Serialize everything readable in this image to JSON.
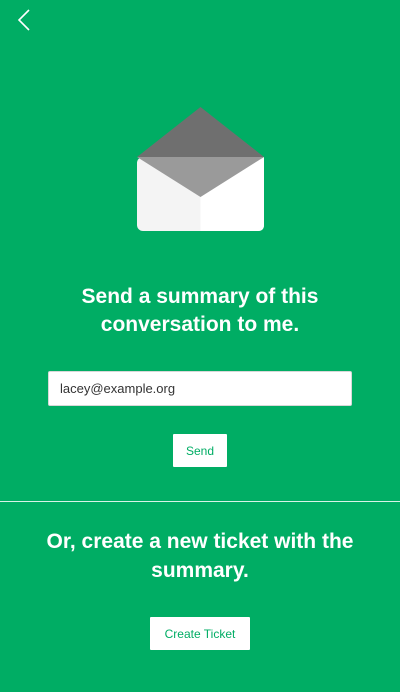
{
  "header": {
    "back_icon": "chevron-left-icon"
  },
  "illustration": {
    "icon": "envelope-icon"
  },
  "summary": {
    "title_line1": "Send a summary of this",
    "title_line2": "conversation to me.",
    "email_value": "lacey@example.org",
    "send_label": "Send"
  },
  "ticket": {
    "title_line1": "Or, create a new ticket with the",
    "title_line2": "summary.",
    "create_label": "Create Ticket"
  },
  "colors": {
    "background": "#00ad64",
    "button_text": "#00ad64",
    "button_bg": "#ffffff"
  }
}
